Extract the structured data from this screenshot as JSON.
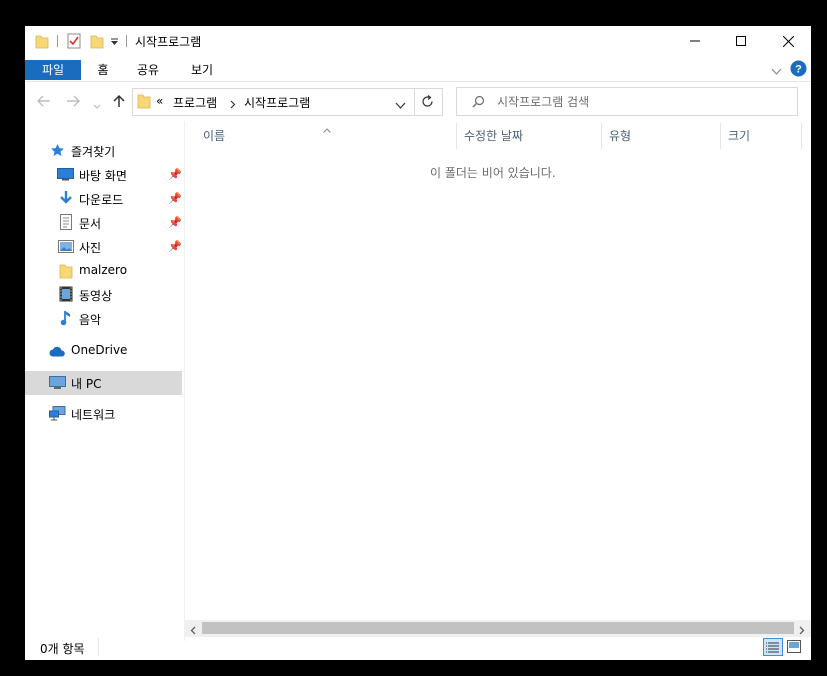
{
  "window": {
    "title": "시작프로그램"
  },
  "ribbon": {
    "tabs": [
      "파일",
      "홈",
      "공유",
      "보기"
    ]
  },
  "address": {
    "overflow": "«",
    "crumbs": [
      "프로그램",
      "시작프로그램"
    ]
  },
  "search": {
    "placeholder": "시작프로그램 검색"
  },
  "sidebar": {
    "quick_access": "즐겨찾기",
    "items": [
      "바탕 화면",
      "다운로드",
      "문서",
      "사진",
      "malzero",
      "동영상",
      "음악"
    ],
    "onedrive": "OneDrive",
    "this_pc": "내 PC",
    "network": "네트워크"
  },
  "columns": [
    "이름",
    "수정한 날짜",
    "유형",
    "크기"
  ],
  "content": {
    "empty_message": "이 폴더는 비어 있습니다."
  },
  "status": {
    "item_count": "0개 항목"
  },
  "colors": {
    "accent": "#1a6cbf",
    "folder": "#f8d775",
    "selected": "#d9d9d9",
    "help": "#1a6cbf"
  }
}
